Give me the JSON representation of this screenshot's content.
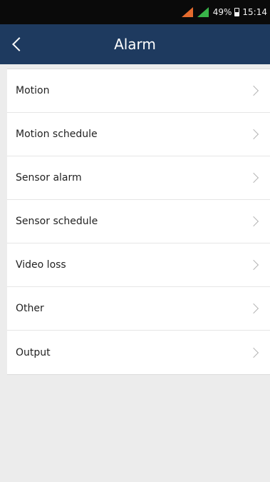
{
  "status_bar": {
    "battery_level": "49%",
    "time": "15:14",
    "icons": [
      "signal-orange-icon",
      "signal-green-icon",
      "battery-icon"
    ]
  },
  "header": {
    "title": "Alarm",
    "back_icon": "chevron-left-icon"
  },
  "menu": {
    "items": [
      {
        "label": "Motion"
      },
      {
        "label": "Motion schedule"
      },
      {
        "label": "Sensor alarm"
      },
      {
        "label": "Sensor schedule"
      },
      {
        "label": "Video loss"
      },
      {
        "label": "Other"
      },
      {
        "label": "Output"
      }
    ]
  },
  "colors": {
    "status_bar": "#0a0a0a",
    "app_bar": "#1e3a5f",
    "background": "#ececec",
    "list_background": "#ffffff"
  }
}
